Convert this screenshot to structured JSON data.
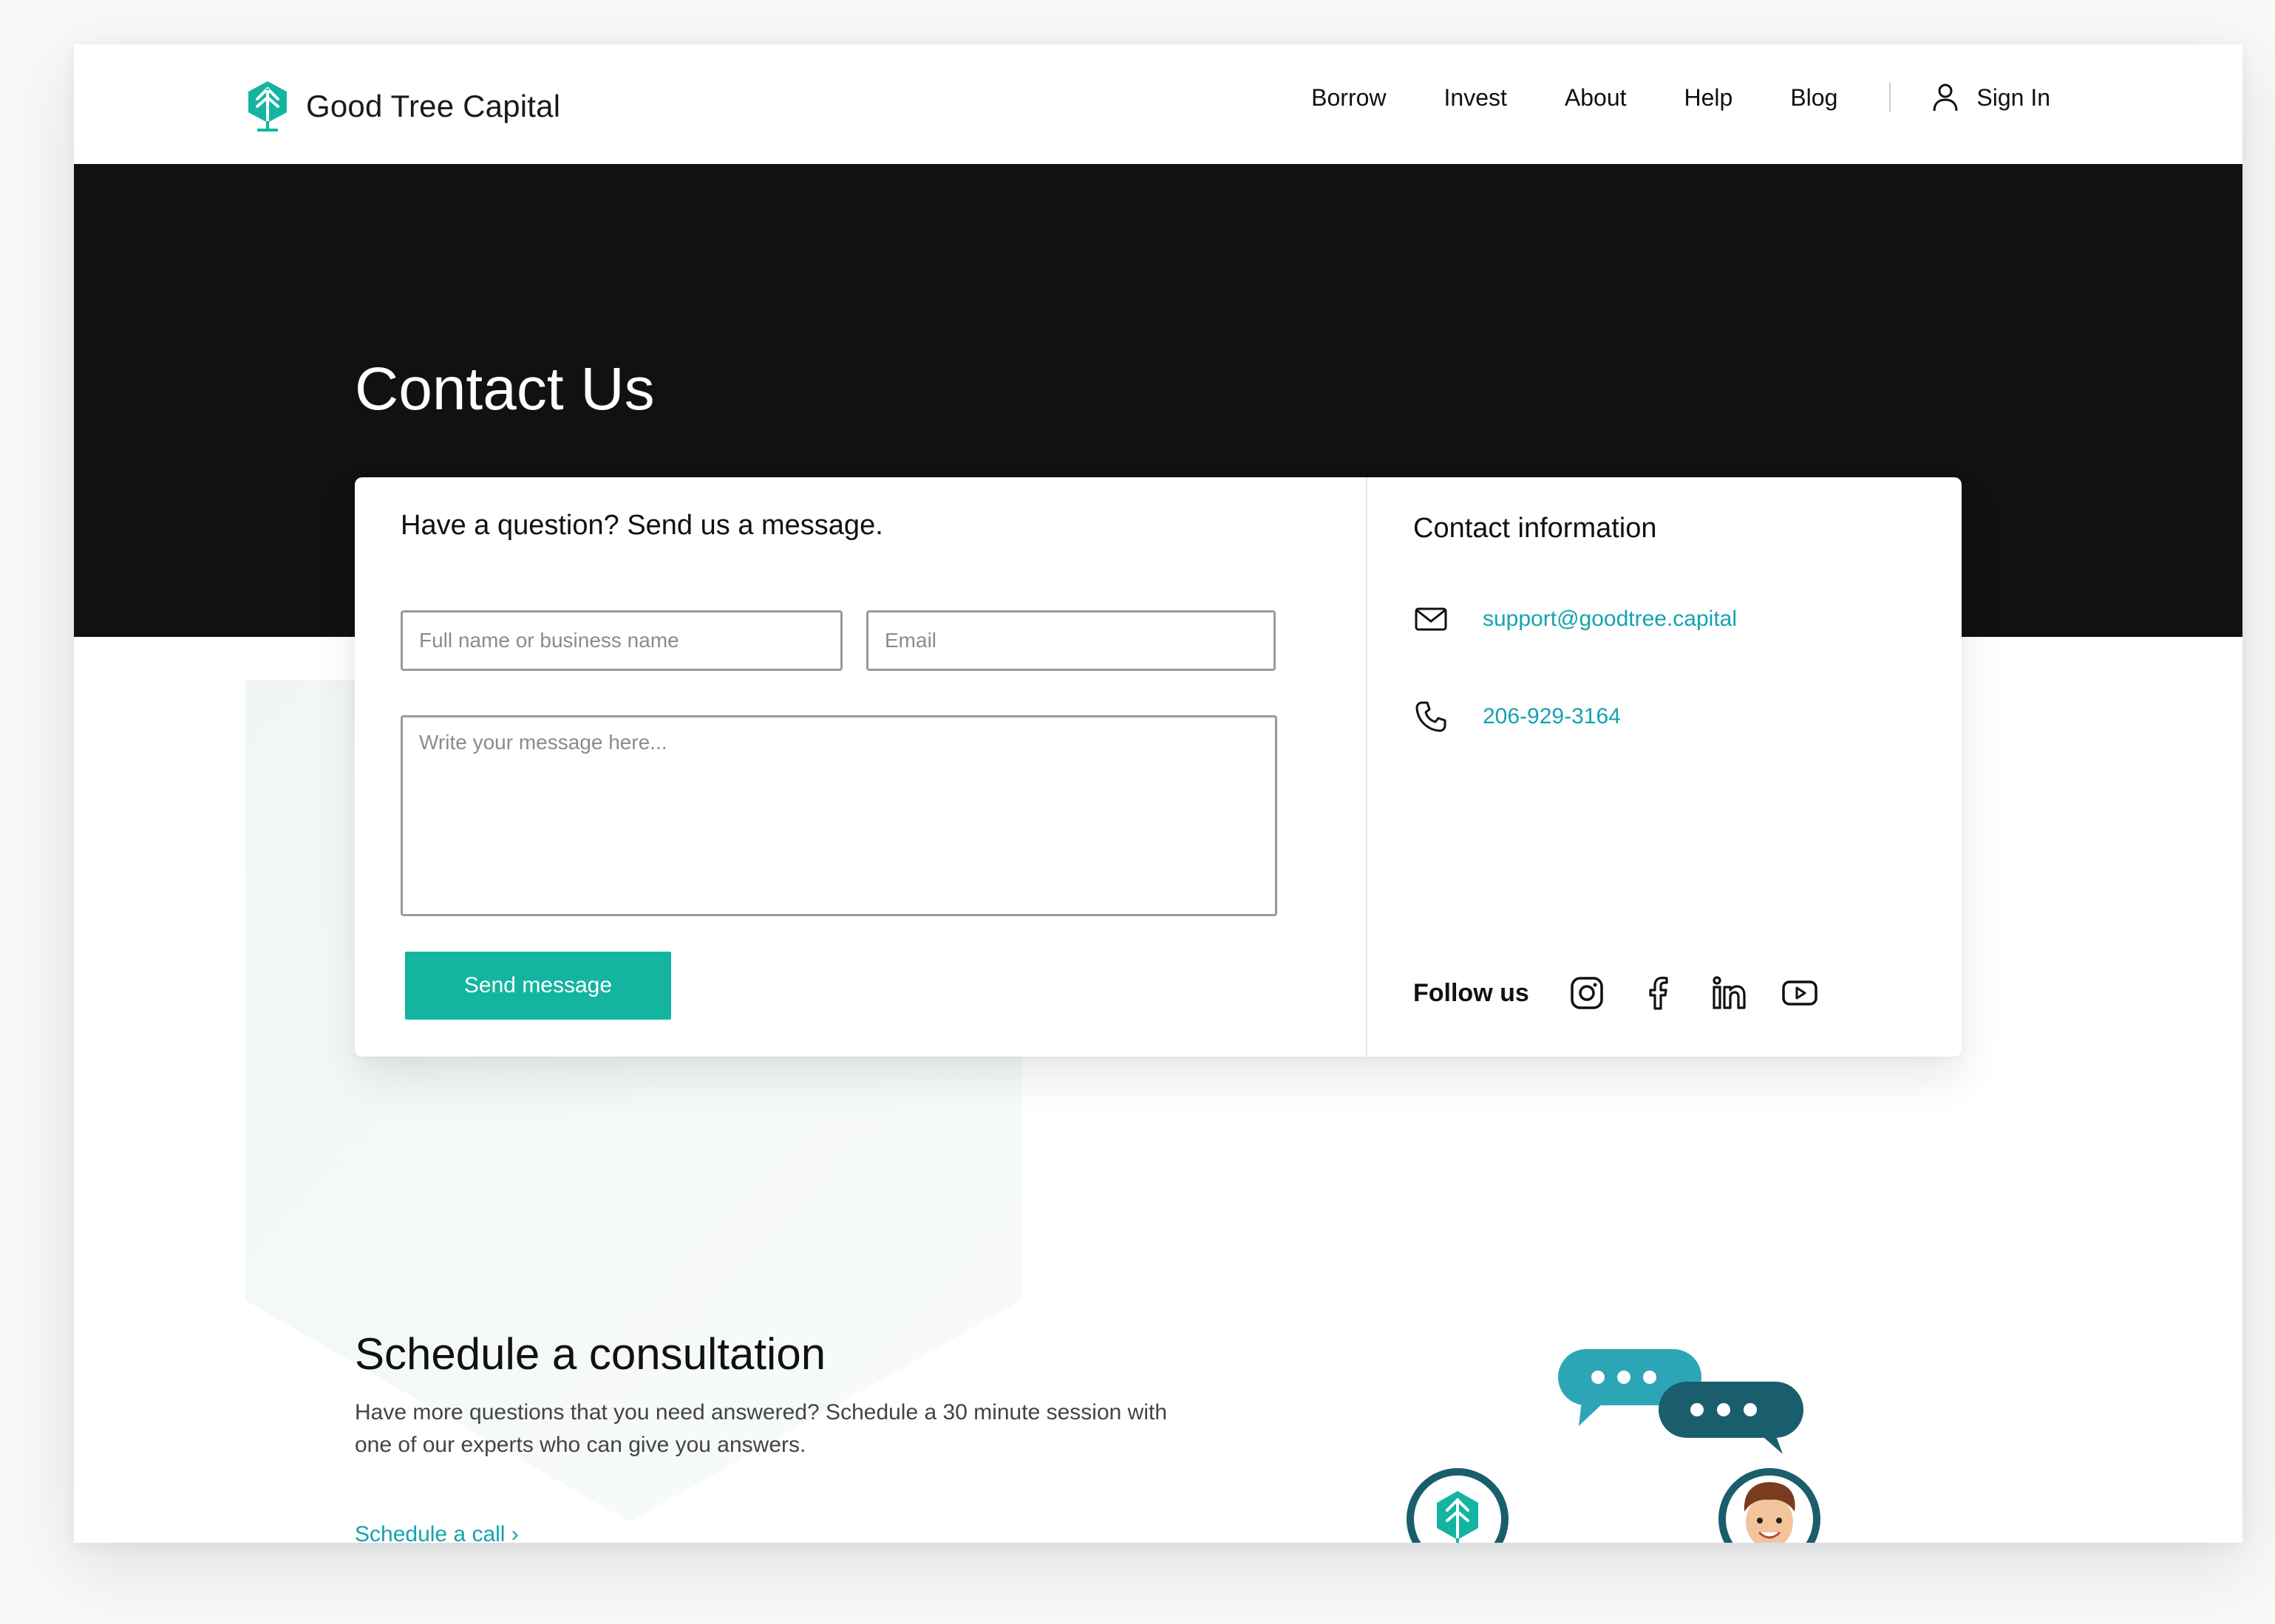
{
  "brand": {
    "name": "Good Tree Capital",
    "logo_icon": "tree-hexagon-icon",
    "accent": "#13b5a0",
    "link_color": "#13a3b0"
  },
  "nav": {
    "items": [
      {
        "label": "Borrow"
      },
      {
        "label": "Invest"
      },
      {
        "label": "About"
      },
      {
        "label": "Help"
      },
      {
        "label": "Blog"
      }
    ],
    "signin_label": "Sign In",
    "signin_icon": "user-icon"
  },
  "hero": {
    "title": "Contact Us",
    "background": "#101212"
  },
  "form": {
    "heading": "Have a question? Send us a message.",
    "name_placeholder": "Full name or business name",
    "name_value": "",
    "email_placeholder": "Email",
    "email_value": "",
    "message_placeholder": "Write your message here...",
    "message_value": "",
    "send_label": "Send message"
  },
  "contact": {
    "heading": "Contact information",
    "email": "support@goodtree.capital",
    "email_icon": "envelope-icon",
    "phone": "206-929-3164",
    "phone_icon": "phone-icon",
    "follow_label": "Follow us",
    "social": [
      "instagram-icon",
      "facebook-icon",
      "linkedin-icon",
      "youtube-icon"
    ]
  },
  "consultation": {
    "title": "Schedule a consultation",
    "description": "Have more questions that you need answered? Schedule a 30 minute session with one of our experts who can give you answers.",
    "link_label": "Schedule a call ›"
  }
}
